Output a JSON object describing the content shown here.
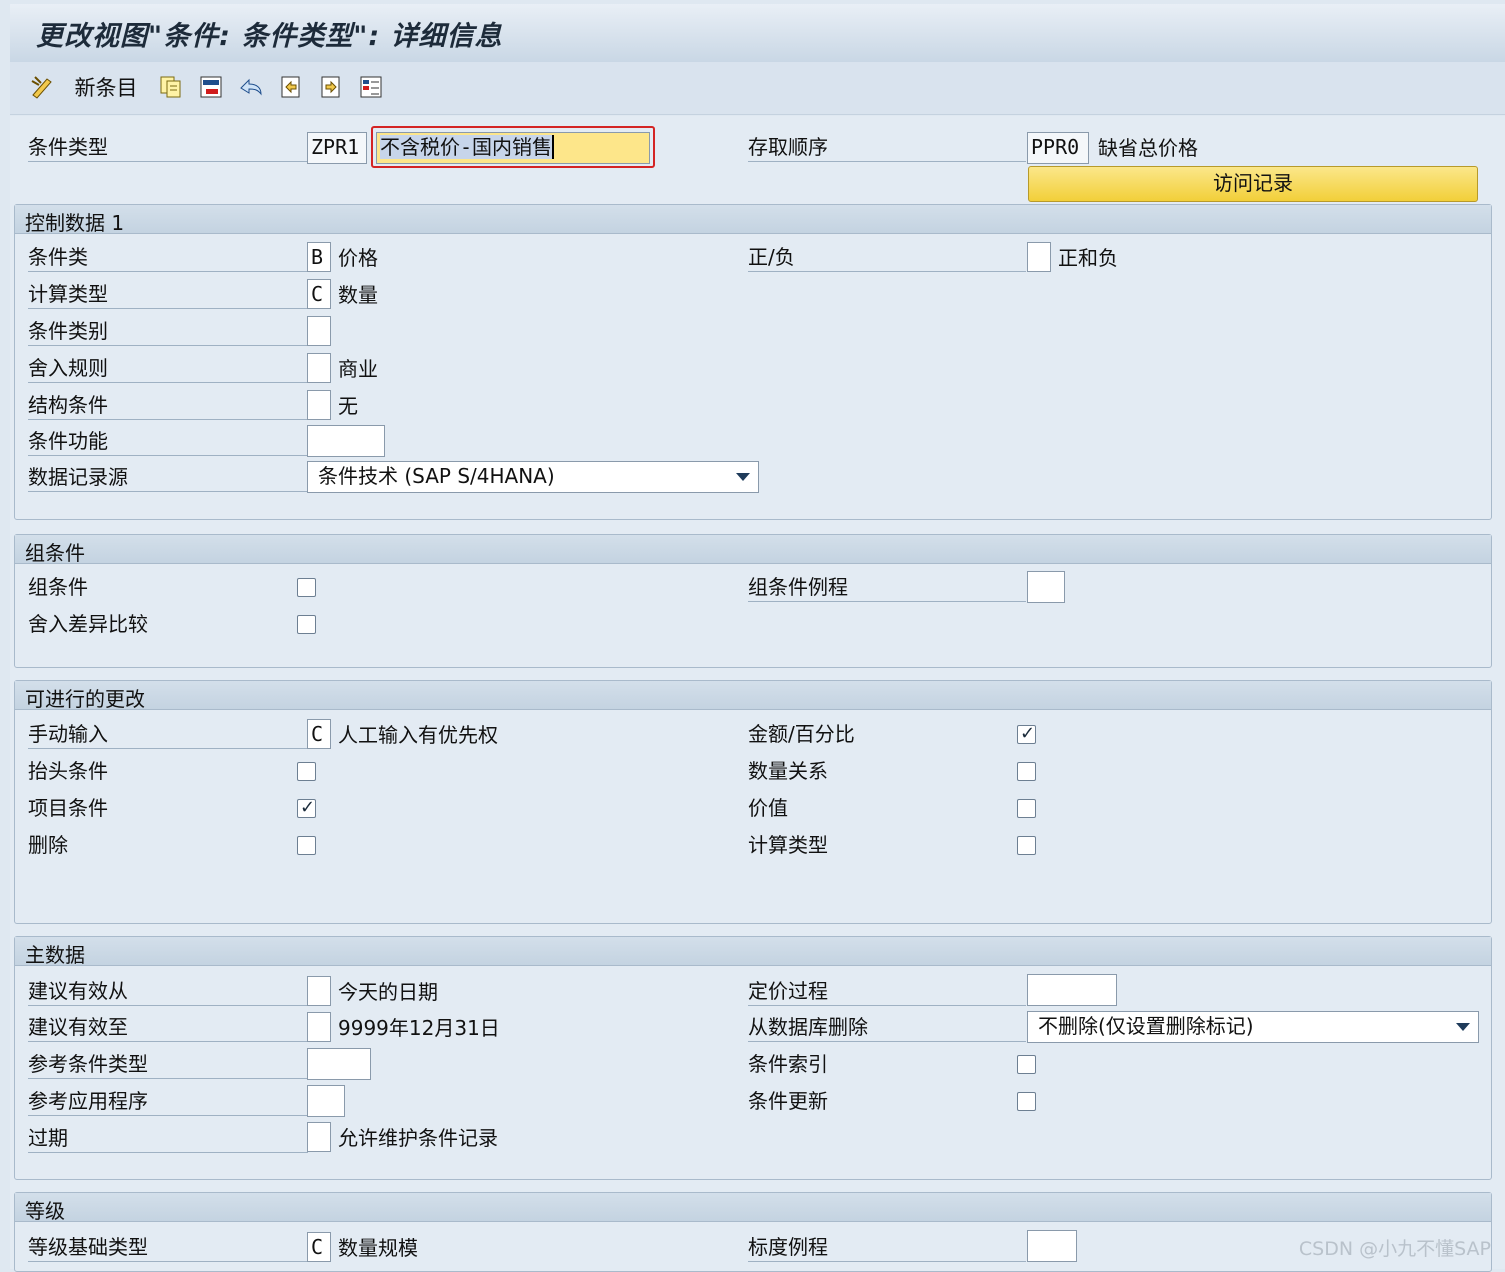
{
  "window": {
    "title": "更改视图\"条件: 条件类型\": 详细信息"
  },
  "toolbar": {
    "new_entries_label": "新条目"
  },
  "header": {
    "condition_type_label": "条件类型",
    "condition_type_code": "ZPR1",
    "condition_type_desc": "不含税价-国内销售",
    "access_seq_label": "存取顺序",
    "access_seq_code": "PPR0",
    "access_seq_desc": "缺省总价格",
    "records_button": "访问记录"
  },
  "control_data": {
    "title": "控制数据 1",
    "cond_class_label": "条件类",
    "cond_class_value": "B",
    "cond_class_text": "价格",
    "calc_type_label": "计算类型",
    "calc_type_value": "C",
    "calc_type_text": "数量",
    "cond_category_label": "条件类别",
    "rounding_label": "舍入规则",
    "rounding_text": "商业",
    "structure_label": "结构条件",
    "structure_text": "无",
    "function_label": "条件功能",
    "data_source_label": "数据记录源",
    "data_source_value": "条件技术 (SAP S/4HANA)",
    "plus_minus_label": "正/负",
    "plus_minus_text": "正和负"
  },
  "group_cond": {
    "title": "组条件",
    "group_cond_label": "组条件",
    "round_diff_label": "舍入差异比较",
    "group_routine_label": "组条件例程"
  },
  "changes": {
    "title": "可进行的更改",
    "manual_label": "手动输入",
    "manual_value": "C",
    "manual_text": "人工输入有优先权",
    "header_cond_label": "抬头条件",
    "item_cond_label": "项目条件",
    "delete_label": "删除",
    "amount_pct_label": "金额/百分比",
    "qty_rel_label": "数量关系",
    "value_label": "价值",
    "calc_type_label": "计算类型"
  },
  "master_data": {
    "title": "主数据",
    "valid_from_label": "建议有效从",
    "valid_from_text": "今天的日期",
    "valid_to_label": "建议有效至",
    "valid_to_text": "9999年12月31日",
    "ref_cond_type_label": "参考条件类型",
    "ref_app_label": "参考应用程序",
    "expired_label": "过期",
    "expired_text": "允许维护条件记录",
    "pricing_proc_label": "定价过程",
    "delete_db_label": "从数据库删除",
    "delete_db_value": "不删除(仅设置删除标记)",
    "cond_index_label": "条件索引",
    "cond_update_label": "条件更新"
  },
  "scales": {
    "title": "等级",
    "scale_base_label": "等级基础类型",
    "scale_base_value": "C",
    "scale_base_text": "数量规模",
    "scale_routine_label": "标度例程"
  },
  "watermark": "CSDN @小九不懂SAP"
}
